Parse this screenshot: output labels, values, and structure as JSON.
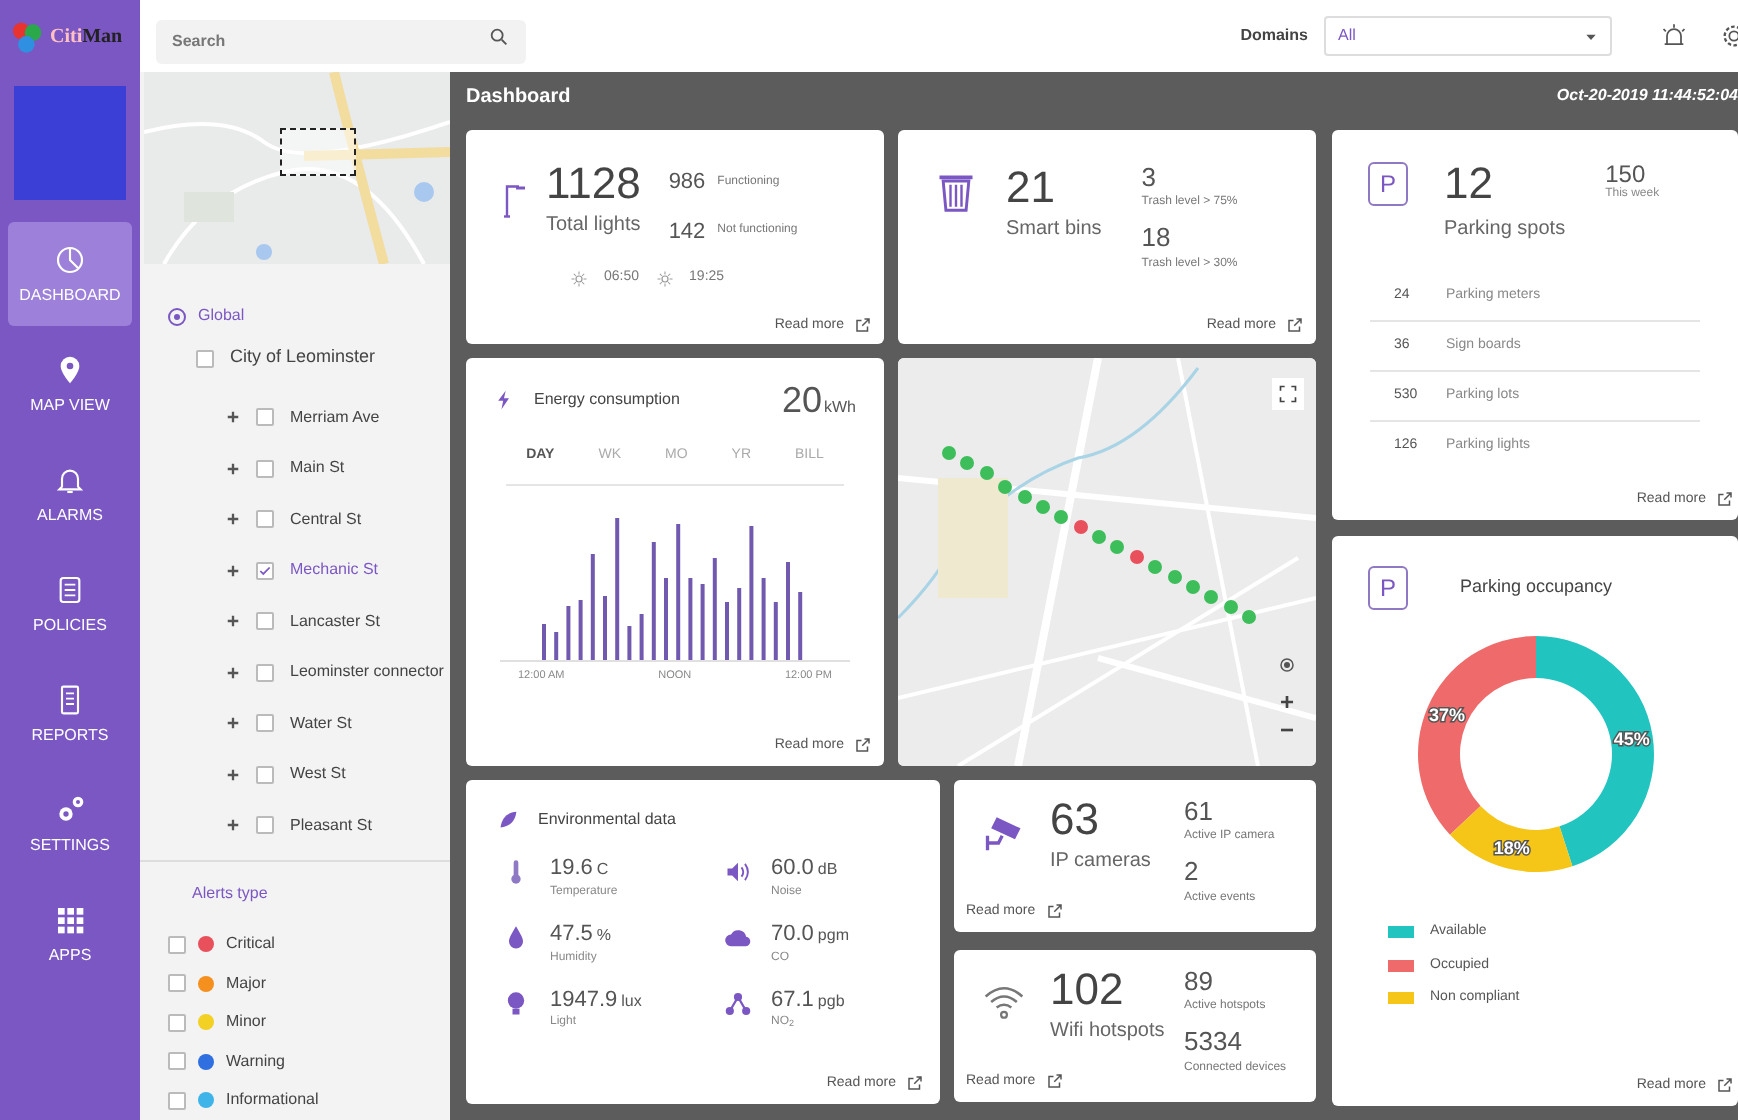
{
  "logo": {
    "text_1": "Citi",
    "text_2": "Man"
  },
  "nav": [
    {
      "label": "DASHBOARD",
      "kind": "dashboard",
      "selected": true
    },
    {
      "label": "MAP VIEW",
      "kind": "map",
      "selected": false
    },
    {
      "label": "ALARMS",
      "kind": "alarms",
      "selected": false
    },
    {
      "label": "POLICIES",
      "kind": "policies",
      "selected": false
    },
    {
      "label": "REPORTS",
      "kind": "reports",
      "selected": false
    },
    {
      "label": "SETTINGS",
      "kind": "settings",
      "selected": false
    },
    {
      "label": "APPS",
      "kind": "apps",
      "selected": false
    }
  ],
  "search": {
    "placeholder": "Search"
  },
  "domains": {
    "label": "Domains",
    "value": "All"
  },
  "tree": [
    {
      "label": "Global",
      "selected": true,
      "children": [
        {
          "label": "City of Leominster",
          "checked": false,
          "children": [
            {
              "label": "Merriam Ave",
              "checked": false,
              "expanded": false
            },
            {
              "label": "Main St",
              "checked": false,
              "expanded": false
            },
            {
              "label": "Central St",
              "checked": false,
              "expanded": false
            },
            {
              "label": "Mechanic St",
              "checked": true,
              "expanded": false
            },
            {
              "label": "Lancaster St",
              "checked": false,
              "expanded": false
            },
            {
              "label": "Leominster connector",
              "checked": false,
              "expanded": false
            },
            {
              "label": "Water St",
              "checked": false,
              "expanded": false
            },
            {
              "label": "West St",
              "checked": false,
              "expanded": false
            },
            {
              "label": "Pleasant St",
              "checked": false,
              "expanded": false
            }
          ]
        }
      ]
    }
  ],
  "alerts": {
    "title": "Alerts type",
    "items": [
      {
        "label": "Critical",
        "checked": false,
        "color": "#e8505b"
      },
      {
        "label": "Major",
        "checked": false,
        "color": "#f5901e"
      },
      {
        "label": "Minor",
        "checked": false,
        "color": "#f2d024"
      },
      {
        "label": "Warning",
        "checked": false,
        "color": "#2f6fe0"
      },
      {
        "label": "Informational",
        "checked": false,
        "color": "#3fb4e8"
      }
    ]
  },
  "header": {
    "title": "Dashboard",
    "datetime": "Oct-20-2019 11:44:52:04"
  },
  "lights": {
    "read_more": "Read more",
    "total": "1128",
    "total_label": "Total lights",
    "stats": [
      {
        "value": "986",
        "label": "Functioning"
      },
      {
        "value": "142",
        "label": "Not functioning"
      }
    ],
    "sunrise": "06:50",
    "sunset": "19:25"
  },
  "bins": {
    "read_more": "Read more",
    "total": "21",
    "total_label": "Smart bins",
    "stats": [
      {
        "value": "3",
        "label": "Trash level > 75%"
      },
      {
        "value": "18",
        "label": "Trash level > 30%"
      }
    ]
  },
  "parking": {
    "read_more": "Read more",
    "icon": "P",
    "total": "12",
    "total_label": "Parking spots",
    "week": "150",
    "week_label": "This week",
    "rows": [
      {
        "value": "24",
        "label": "Parking meters"
      },
      {
        "value": "36",
        "label": "Sign boards"
      },
      {
        "value": "530",
        "label": "Parking lots"
      },
      {
        "value": "126",
        "label": "Parking lights"
      }
    ]
  },
  "energy": {
    "read_more": "Read more",
    "title": "Energy consumption",
    "value": "20",
    "unit": "kWh",
    "tabs": [
      {
        "label": "DAY",
        "selected": true
      },
      {
        "label": "WK",
        "selected": false
      },
      {
        "label": "MO",
        "selected": false
      },
      {
        "label": "YR",
        "selected": false
      },
      {
        "label": "BILL",
        "selected": false
      }
    ],
    "axis_labels": [
      "12:00 AM",
      "NOON",
      "12:00 PM"
    ]
  },
  "map": {
    "markers": [
      {
        "color": "#3dbe5a"
      },
      {
        "color": "#3dbe5a"
      },
      {
        "color": "#3dbe5a"
      },
      {
        "color": "#3dbe5a"
      },
      {
        "color": "#3dbe5a"
      },
      {
        "color": "#3dbe5a"
      },
      {
        "color": "#3dbe5a"
      },
      {
        "color": "#e8505b"
      },
      {
        "color": "#3dbe5a"
      },
      {
        "color": "#3dbe5a"
      },
      {
        "color": "#e8505b"
      },
      {
        "color": "#3dbe5a"
      },
      {
        "color": "#3dbe5a"
      },
      {
        "color": "#3dbe5a"
      },
      {
        "color": "#3dbe5a"
      },
      {
        "color": "#3dbe5a"
      },
      {
        "color": "#3dbe5a"
      }
    ],
    "zoom_in": "+",
    "zoom_out": "−"
  },
  "occupancy": {
    "read_more": "Read more",
    "icon": "P",
    "title": "Parking occupancy",
    "chart_data": {
      "type": "donut",
      "categories": [
        "Available",
        "Occupied",
        "Non compliant"
      ],
      "values": [
        45,
        37,
        18
      ],
      "colors": [
        "#22c4c0",
        "#ef6b6b",
        "#f5c518"
      ],
      "value_labels": [
        "45%",
        "37%",
        "18%"
      ]
    }
  },
  "environment": {
    "read_more": "Read more",
    "title": "Environmental data",
    "items": [
      {
        "kind": "temperature",
        "value": "19.6",
        "unit": "C",
        "label": "Temperature"
      },
      {
        "kind": "noise",
        "value": "60.0",
        "unit": "dB",
        "label": "Noise"
      },
      {
        "kind": "humidity",
        "value": "47.5",
        "unit": "%",
        "label": "Humidity"
      },
      {
        "kind": "co",
        "value": "70.0",
        "unit": "pgm",
        "label": "CO"
      },
      {
        "kind": "light",
        "value": "1947.9",
        "unit": "lux",
        "label": "Light"
      },
      {
        "kind": "no2",
        "value": "67.1",
        "unit": "pgb",
        "label": "NO$_{2}$"
      }
    ]
  },
  "cameras": {
    "read_more": "Read more",
    "total": "63",
    "total_label": "IP cameras",
    "stats": [
      {
        "value": "61",
        "label": "Active IP camera"
      },
      {
        "value": "2",
        "label": "Active events"
      }
    ]
  },
  "wifi": {
    "read_more": "Read more",
    "total": "102",
    "total_label": "Wifi hotspots",
    "stats": [
      {
        "value": "89",
        "label": "Active hotspots"
      },
      {
        "value": "5334",
        "label": "Connected devices"
      }
    ]
  }
}
